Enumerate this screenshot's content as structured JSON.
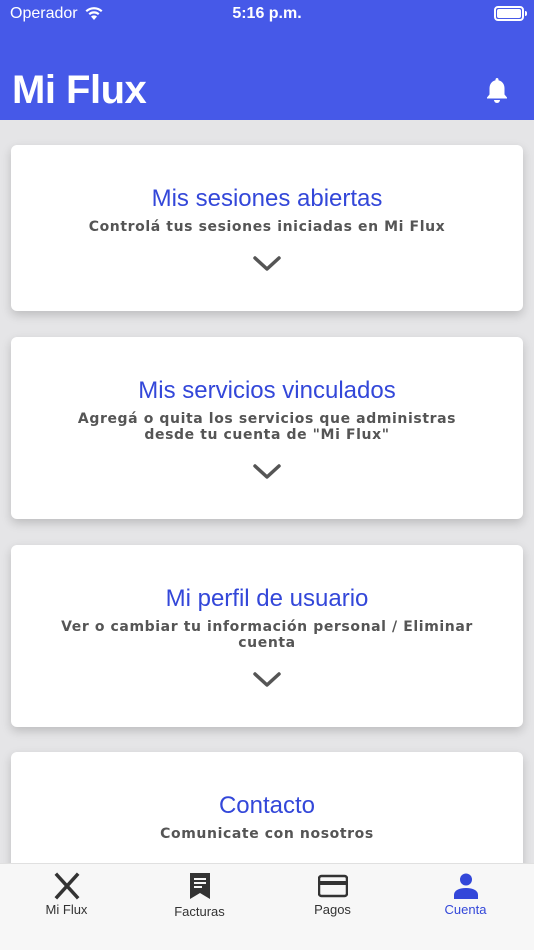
{
  "status_bar": {
    "carrier": "Operador",
    "time": "5:16 p.m."
  },
  "header": {
    "title": "Mi Flux",
    "notification_icon": "bell-icon"
  },
  "colors": {
    "brand": "#4659e8",
    "title": "#3347d9",
    "text": "#555555",
    "background": "#e5e5e7"
  },
  "cards": [
    {
      "title": "Mis sesiones abiertas",
      "subtitle": "Controlá tus sesiones iniciadas en Mi Flux"
    },
    {
      "title": "Mis servicios vinculados",
      "subtitle": "Agregá o quita los servicios que administras desde tu cuenta de \"Mi Flux\""
    },
    {
      "title": "Mi perfil de usuario",
      "subtitle": "Ver o cambiar tu información personal / Eliminar cuenta"
    },
    {
      "title": "Contacto",
      "subtitle": "Comunicate con nosotros"
    }
  ],
  "tabs": [
    {
      "label": "Mi Flux",
      "icon": "x-logo-icon"
    },
    {
      "label": "Facturas",
      "icon": "receipt-icon"
    },
    {
      "label": "Pagos",
      "icon": "credit-card-icon"
    },
    {
      "label": "Cuenta",
      "icon": "user-icon",
      "active": true
    }
  ]
}
